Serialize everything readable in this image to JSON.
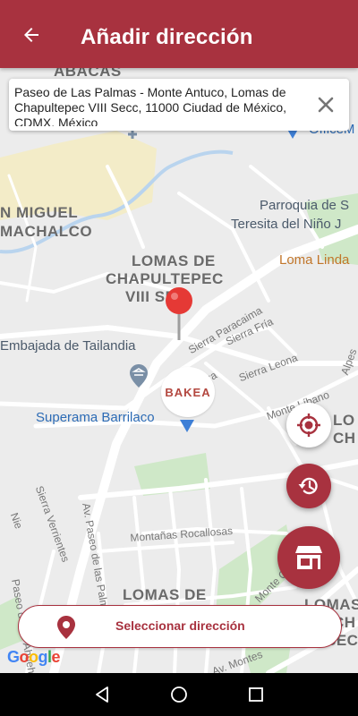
{
  "header": {
    "title": "Añadir dirección"
  },
  "address": {
    "text": "Paseo de Las Palmas - Monte Antuco, Lomas de Chapultepec VIII Secc, 11000 Ciudad de México, CDMX, México"
  },
  "map": {
    "labels": {
      "miguel": "N MIGUEL",
      "machalco": "MACHALCO",
      "lomas1": "LOMAS DE",
      "chapul": "CHAPULTEPEC",
      "viii": "VIII SEC",
      "embajada": "Embajada de Tailandia",
      "superama": "Superama Barrilaco",
      "parroquia1": "Parroquia de S",
      "parroquia2": "Teresita del Niño J",
      "lomalinda": "Loma Linda",
      "officem": "OfficeM",
      "paracaima": "Sierra Paracaima",
      "fria": "Sierra Fría",
      "leona": "Sierra Leona",
      "sierra": "Sierra",
      "monteli": "Monte Líbano",
      "alpes": "Alpes",
      "lo": "LO",
      "ch": "CH",
      "verrientes": "Sierra Verrientes",
      "rocallosas": "Montañas Rocallosas",
      "paseo": "Av. Paseo de las Palmas",
      "ahuehuetes": "Paseo de los Ahuehuetes",
      "nie": "Nie",
      "lomas2": "LOMAS DE",
      "montec": "Monte C",
      "avmontes": "Av. Montes",
      "lomasd": "LOMAS D",
      "ch2": "CH",
      "secc": "SECC",
      "abacas": "ABACAS",
      "bakea": "BAKEA"
    }
  },
  "select_button": {
    "label": "Seleccionar dirección"
  },
  "google": {
    "letters": [
      "G",
      "o",
      "o",
      "g",
      "l",
      "e"
    ]
  },
  "colors": {
    "brand": "#a8323f"
  }
}
